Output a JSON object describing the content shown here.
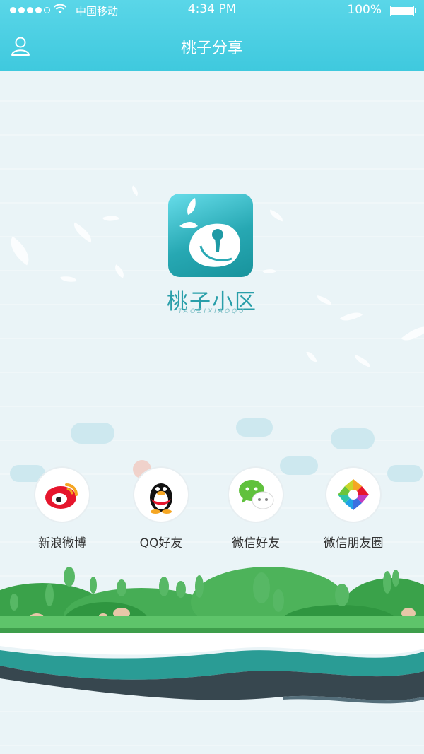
{
  "status_bar": {
    "carrier": "中国移动",
    "time": "4:34 PM",
    "battery": "100%"
  },
  "header": {
    "title": "桃子分享",
    "icon": "user-icon"
  },
  "logo": {
    "name": "桃子小区",
    "subtitle": "TAOZIXIAOQU"
  },
  "share": {
    "items": [
      {
        "label": "新浪微博",
        "icon": "weibo-icon"
      },
      {
        "label": "QQ好友",
        "icon": "qq-icon"
      },
      {
        "label": "微信好友",
        "icon": "wechat-icon"
      },
      {
        "label": "微信朋友圈",
        "icon": "moments-icon"
      }
    ]
  },
  "colors": {
    "header": "#47cce0",
    "accent": "#2a9faa",
    "grass": "#4db35a"
  }
}
